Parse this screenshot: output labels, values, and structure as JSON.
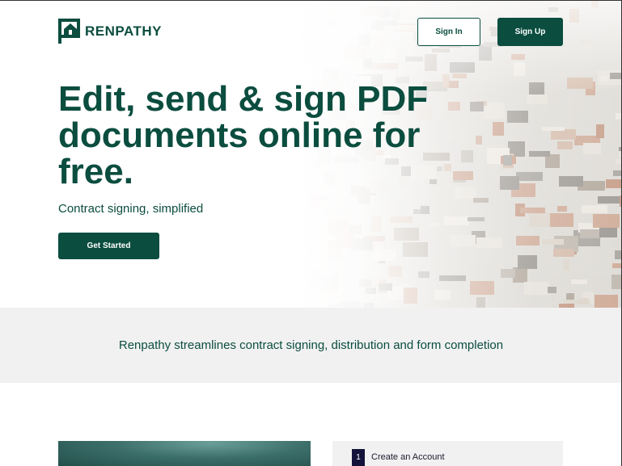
{
  "header": {
    "brand": "RENPATHY",
    "logo_icon": "house-frame-icon",
    "sign_in_label": "Sign In",
    "sign_up_label": "Sign Up"
  },
  "hero": {
    "headline": "Edit, send & sign PDF documents online for free.",
    "subheadline": "Contract signing, simplified",
    "cta_label": "Get Started"
  },
  "band": {
    "text": "Renpathy streamlines contract signing, distribution and form completion"
  },
  "steps": [
    {
      "number": "1",
      "label": "Create an Account"
    }
  ],
  "colors": {
    "brand_green": "#0b4d3f",
    "band_background": "#f1f1f1",
    "step_badge": "#12123a"
  }
}
